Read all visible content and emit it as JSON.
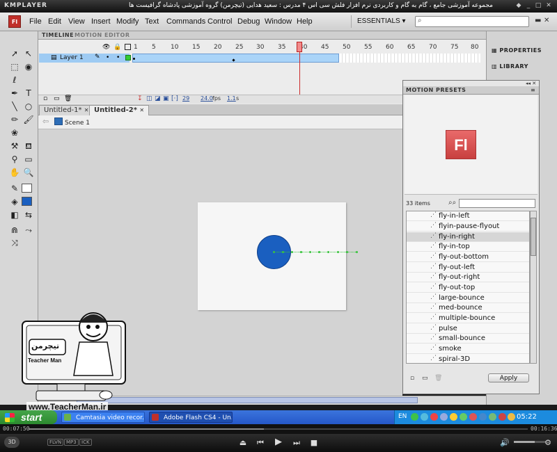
{
  "player": {
    "logo": "KMPLAYER",
    "title": "مجموعه آموزشی جامع ، گام به گام و کاربردی نرم افزار فلش سی اس ۴ مدرس : سعید هدایی (تیچرمن) گروه آموزشی پادشاه گرافیست ها",
    "time_elapsed": "00:07:50",
    "time_total": "00:16:36",
    "progress_fraction": 0.47,
    "badges": [
      "FLVN",
      "MP3",
      "ICK"
    ],
    "three_d": "3D"
  },
  "app": {
    "logo": "Fl",
    "menu": [
      "File",
      "Edit",
      "View",
      "Insert",
      "Modify",
      "Text",
      "Commands",
      "Control",
      "Debug",
      "Window",
      "Help"
    ],
    "workspace": "ESSENTIALS",
    "search_placeholder": ""
  },
  "timeline": {
    "tabs": [
      "TIMELINE",
      "MOTION EDITOR"
    ],
    "ruler": [
      "1",
      "5",
      "10",
      "15",
      "20",
      "25",
      "30",
      "35",
      "40",
      "45",
      "50",
      "55",
      "60",
      "65",
      "70",
      "75",
      "80",
      "8"
    ],
    "layer": "Layer 1",
    "current_frame": "29",
    "fps": "24.0",
    "fps_unit": "fps",
    "time": "1.1",
    "time_unit": "s"
  },
  "documents": {
    "tabs": [
      "Untitled-1*",
      "Untitled-2*"
    ],
    "scene": "Scene 1"
  },
  "dock": {
    "items": [
      "PROPERTIES",
      "LIBRARY"
    ]
  },
  "motion_presets": {
    "title": "MOTION PRESETS",
    "count": "33 items",
    "items": [
      "fly-in-left",
      "flyin-pause-flyout",
      "fly-in-right",
      "fly-in-top",
      "fly-out-bottom",
      "fly-out-left",
      "fly-out-right",
      "fly-out-top",
      "large-bounce",
      "med-bounce",
      "multiple-bounce",
      "pulse",
      "small-bounce",
      "smoke",
      "spiral-3D"
    ],
    "selected_index": 2,
    "apply_label": "Apply"
  },
  "overlay": {
    "logo_text": "تیچرمن",
    "name": "Teacher Man",
    "site": "www.TeacherMan.ir"
  },
  "taskbar": {
    "start": "start",
    "tasks": [
      "Camtasia video recor...",
      "Adobe Flash CS4 - Un..."
    ],
    "lang": "EN",
    "clock": "05:22"
  },
  "colors": {
    "circle": "#1a5fc0",
    "playhead": "#cc2a2a",
    "taskbar": "#2558c8"
  }
}
